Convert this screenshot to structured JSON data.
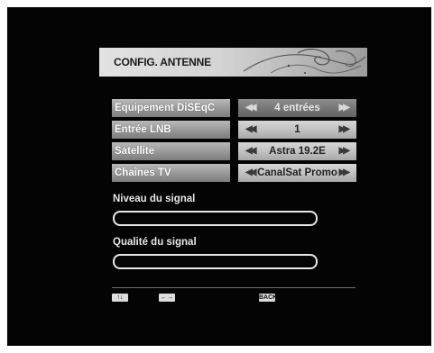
{
  "header": {
    "title": "CONFIG. ANTENNE"
  },
  "settings": [
    {
      "label": "Equipement DiSEqC",
      "value": "4 entrées"
    },
    {
      "label": "Entrée LNB",
      "value": "1"
    },
    {
      "label": "Satellite",
      "value": "Astra 19.2E"
    },
    {
      "label": "Chaînes TV",
      "value": "CanalSat Promo"
    }
  ],
  "signal": {
    "level_label": "Niveau du signal",
    "quality_label": "Qualité du signal"
  },
  "footer": {
    "updown_key": "↑↓",
    "leftright_key": "←→",
    "back_key": "BACK"
  },
  "colors": {
    "screen_bg": "#040404",
    "row_label": "#9a9a9a",
    "row_value": "#c2c2c2",
    "row_active": "#777777"
  }
}
